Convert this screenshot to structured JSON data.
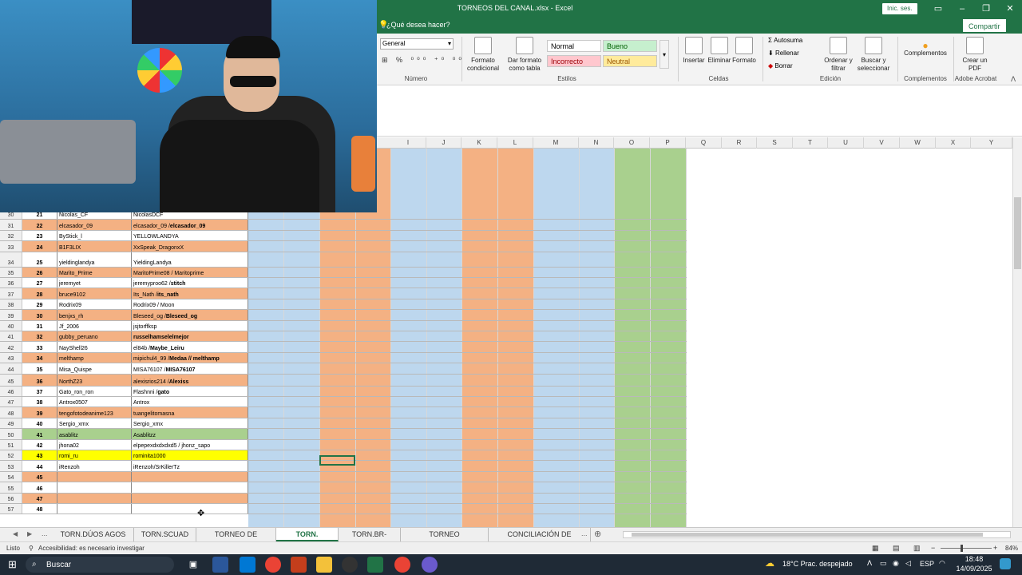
{
  "window": {
    "title": "TORNEOS DEL CANAL.xlsx  -  Excel",
    "signin": "Inic. ses.",
    "share": "Compartir"
  },
  "tell_me": "¿Qué desea hacer?",
  "ribbon": {
    "number_format": "General",
    "number_group": "Número",
    "cond_format": "Formato condicional",
    "format_table": "Dar formato como tabla",
    "styles": {
      "normal": "Normal",
      "good": "Bueno",
      "bad": "Incorrecto",
      "neutral": "Neutral"
    },
    "styles_group": "Estilos",
    "insert": "Insertar",
    "delete": "Eliminar",
    "format": "Formato",
    "cells_group": "Celdas",
    "autosum": "Autosuma",
    "fill": "Rellenar",
    "clear": "Borrar",
    "sort_filter": "Ordenar y filtrar",
    "find_select": "Buscar y seleccionar",
    "editing_group": "Edición",
    "addins": "Complementos",
    "addins_group": "Complementos",
    "create_pdf": "Crear un PDF",
    "acrobat_group": "Adobe Acrobat"
  },
  "columns": [
    "I",
    "J",
    "K",
    "L",
    "M",
    "N",
    "O",
    "P",
    "Q",
    "R",
    "S",
    "T",
    "U",
    "V",
    "W",
    "X",
    "Y"
  ],
  "rows": [
    {
      "n": "30",
      "num": "21",
      "user": "Nicolas_CF",
      "roblox": "NicolasDCF",
      "color": "#ffffff",
      "bold": ""
    },
    {
      "n": "31",
      "num": "22",
      "user": "elcasador_09",
      "roblox": "elcasador_09 / ",
      "bold": "elcasador_09",
      "color": "#f4b183"
    },
    {
      "n": "32",
      "num": "23",
      "user": "ByStick_l",
      "roblox": "YELLOWLANDYA",
      "color": "#ffffff",
      "bold": ""
    },
    {
      "n": "33",
      "num": "24",
      "user": "B1F3LIX",
      "roblox": "XxSpeak_DragonxX",
      "color": "#f4b183",
      "bold": ""
    },
    {
      "n": "34",
      "num": "25",
      "user": "yieldinglandya",
      "roblox": "YieldingLandya",
      "color": "#ffffff",
      "bold": ""
    },
    {
      "n": "35",
      "num": "26",
      "user": "Marito_Prime",
      "roblox": "MaritoPrime08 / Maritoprime",
      "color": "#f4b183",
      "bold": ""
    },
    {
      "n": "36",
      "num": "27",
      "user": "jeremyet",
      "roblox": "jeremyproo62 / ",
      "bold": "stitch",
      "color": "#ffffff"
    },
    {
      "n": "37",
      "num": "28",
      "user": " bruce9102",
      "roblox": "Its_Nath / ",
      "bold": "its_nath",
      "color": "#f4b183"
    },
    {
      "n": "38",
      "num": "29",
      "user": "Rodrix09",
      "roblox": "Rodrix09 / Moon",
      "color": "#ffffff",
      "bold": ""
    },
    {
      "n": "39",
      "num": "30",
      "user": "benjxs_rh",
      "roblox": "Bleseed_og / ",
      "bold": "Bleseed_og",
      "color": "#f4b183"
    },
    {
      "n": "40",
      "num": "31",
      "user": "Jf_2006",
      "roblox": "jsjtorffksp",
      "color": "#ffffff",
      "bold": ""
    },
    {
      "n": "41",
      "num": "32",
      "user": " gubby_peruano",
      "roblox": "",
      "bold": "russelhamselelmejor",
      "color": "#f4b183"
    },
    {
      "n": "42",
      "num": "33",
      "user": "NayShell26",
      "roblox": "el84b / ",
      "bold": "Maybe_Leiru",
      "color": "#ffffff"
    },
    {
      "n": "43",
      "num": "34",
      "user": "melthamp",
      "roblox": "mipichul4_99 / ",
      "bold": "Medaa //  melthamp",
      "color": "#f4b183"
    },
    {
      "n": "44",
      "num": "35",
      "user": "Misa_Quispe",
      "roblox": "MISA76107 / ",
      "bold": "MISA76107",
      "color": "#ffffff"
    },
    {
      "n": "45",
      "num": "36",
      "user": "NorthZ23",
      "roblox": "alexisrios214 / ",
      "bold": "Alexiss",
      "color": "#f4b183"
    },
    {
      "n": "46",
      "num": "37",
      "user": "Gato_ron_ron",
      "roblox": "Flashnni / ",
      "bold": "gato",
      "color": "#ffffff"
    },
    {
      "n": "47",
      "num": "38",
      "user": " Antrox0507",
      "roblox": "Antrox",
      "color": "#ffffff",
      "bold": ""
    },
    {
      "n": "48",
      "num": "39",
      "user": "tengofotodeanime123",
      "roblox": "tuangelitomasna",
      "color": "#f4b183",
      "bold": ""
    },
    {
      "n": "49",
      "num": "40",
      "user": "Sergio_xmx",
      "roblox": "Sergio_xmx",
      "color": "#ffffff",
      "bold": ""
    },
    {
      "n": "50",
      "num": "41",
      "user": "asablitz",
      "roblox": "Asablitzz",
      "color": "#a9d08e",
      "bold": ""
    },
    {
      "n": "51",
      "num": "42",
      "user": "jhona02",
      "roblox": "elpepexdxdxdxd5 /  jhonz_sapo",
      "color": "#ffffff",
      "bold": ""
    },
    {
      "n": "52",
      "num": "43",
      "user": "romi_ru",
      "roblox": "rominita1000",
      "color": "#ffff00",
      "bold": ""
    },
    {
      "n": "53",
      "num": "44",
      "user": "iRenzoh",
      "roblox": "iRenzoh/SrKillerTz",
      "color": "#ffffff",
      "bold": ""
    },
    {
      "n": "54",
      "num": "45",
      "user": "",
      "roblox": "",
      "color": "#f4b183",
      "bold": ""
    },
    {
      "n": "55",
      "num": "46",
      "user": "",
      "roblox": "",
      "color": "#ffffff",
      "bold": ""
    },
    {
      "n": "56",
      "num": "47",
      "user": "",
      "roblox": "",
      "color": "#f4b183",
      "bold": ""
    },
    {
      "n": "57",
      "num": "48",
      "user": "",
      "roblox": "",
      "color": "#ffffff",
      "bold": ""
    }
  ],
  "tabs": [
    "TORN.DÚOS AGOS",
    "TORN.SCUAD",
    "TORNEO DE ROBLOX",
    "TORN. ROBLOX",
    "TORN.BR-SOLO",
    "TORNEO RELÁMPAGO",
    "CONCILIACIÓN DE PREMIOS"
  ],
  "active_tab": "TORN. ROBLOX",
  "tabs_more": "...",
  "status": {
    "ready": "Listo",
    "accessibility": "Accesibilidad: es necesario investigar",
    "zoom": "84%"
  },
  "taskbar": {
    "search": "Buscar",
    "weather": "18°C  Prac. despejado",
    "lang": "ESP",
    "time": "18:48",
    "date": "14/09/2025"
  },
  "colors": {
    "excel_green": "#217346",
    "blue_col": "#bdd7ee",
    "orange_col": "#f4b183",
    "green_col": "#a9d08e"
  }
}
